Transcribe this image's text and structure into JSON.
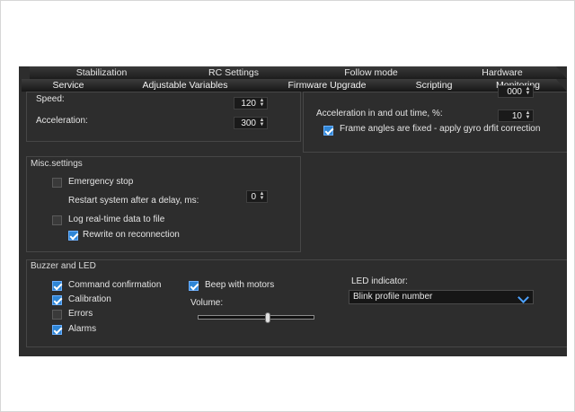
{
  "tabs_top": [
    {
      "label": "Stabilization"
    },
    {
      "label": "RC Settings"
    },
    {
      "label": "Follow mode"
    },
    {
      "label": "Hardware"
    }
  ],
  "tabs_bottom": [
    {
      "label": "Service",
      "active": true
    },
    {
      "label": "Adjustable Variables"
    },
    {
      "label": "Firmware Upgrade"
    },
    {
      "label": "Scripting"
    },
    {
      "label": "Monitoring"
    }
  ],
  "motor": {
    "speed_label": "Speed:",
    "speed_value": "120",
    "accel_label": "Acceleration:",
    "accel_value": "300"
  },
  "follow": {
    "top_value": "000",
    "accel_time_label": "Acceleration in and out time, %:",
    "accel_time_value": "10",
    "frame_angles_label": "Frame angles are fixed - apply gyro drfit correction",
    "frame_angles_checked": true
  },
  "misc": {
    "title": "Misc.settings",
    "emergency_stop": "Emergency stop",
    "emergency_stop_checked": false,
    "restart_label": "Restart system after a delay, ms:",
    "restart_value": "0",
    "log_label": "Log real-time data to file",
    "log_checked": false,
    "rewrite_label": "Rewrite on reconnection",
    "rewrite_checked": true
  },
  "buzzer": {
    "title": "Buzzer and LED",
    "items": [
      {
        "label": "Command confirmation",
        "checked": true
      },
      {
        "label": "Calibration",
        "checked": true
      },
      {
        "label": "Errors",
        "checked": false
      },
      {
        "label": "Alarms",
        "checked": true
      }
    ],
    "beep_label": "Beep with motors",
    "beep_checked": true,
    "volume_label": "Volume:",
    "volume_level": 0.6,
    "led_label": "LED indicator:",
    "led_value": "Blink profile number"
  }
}
